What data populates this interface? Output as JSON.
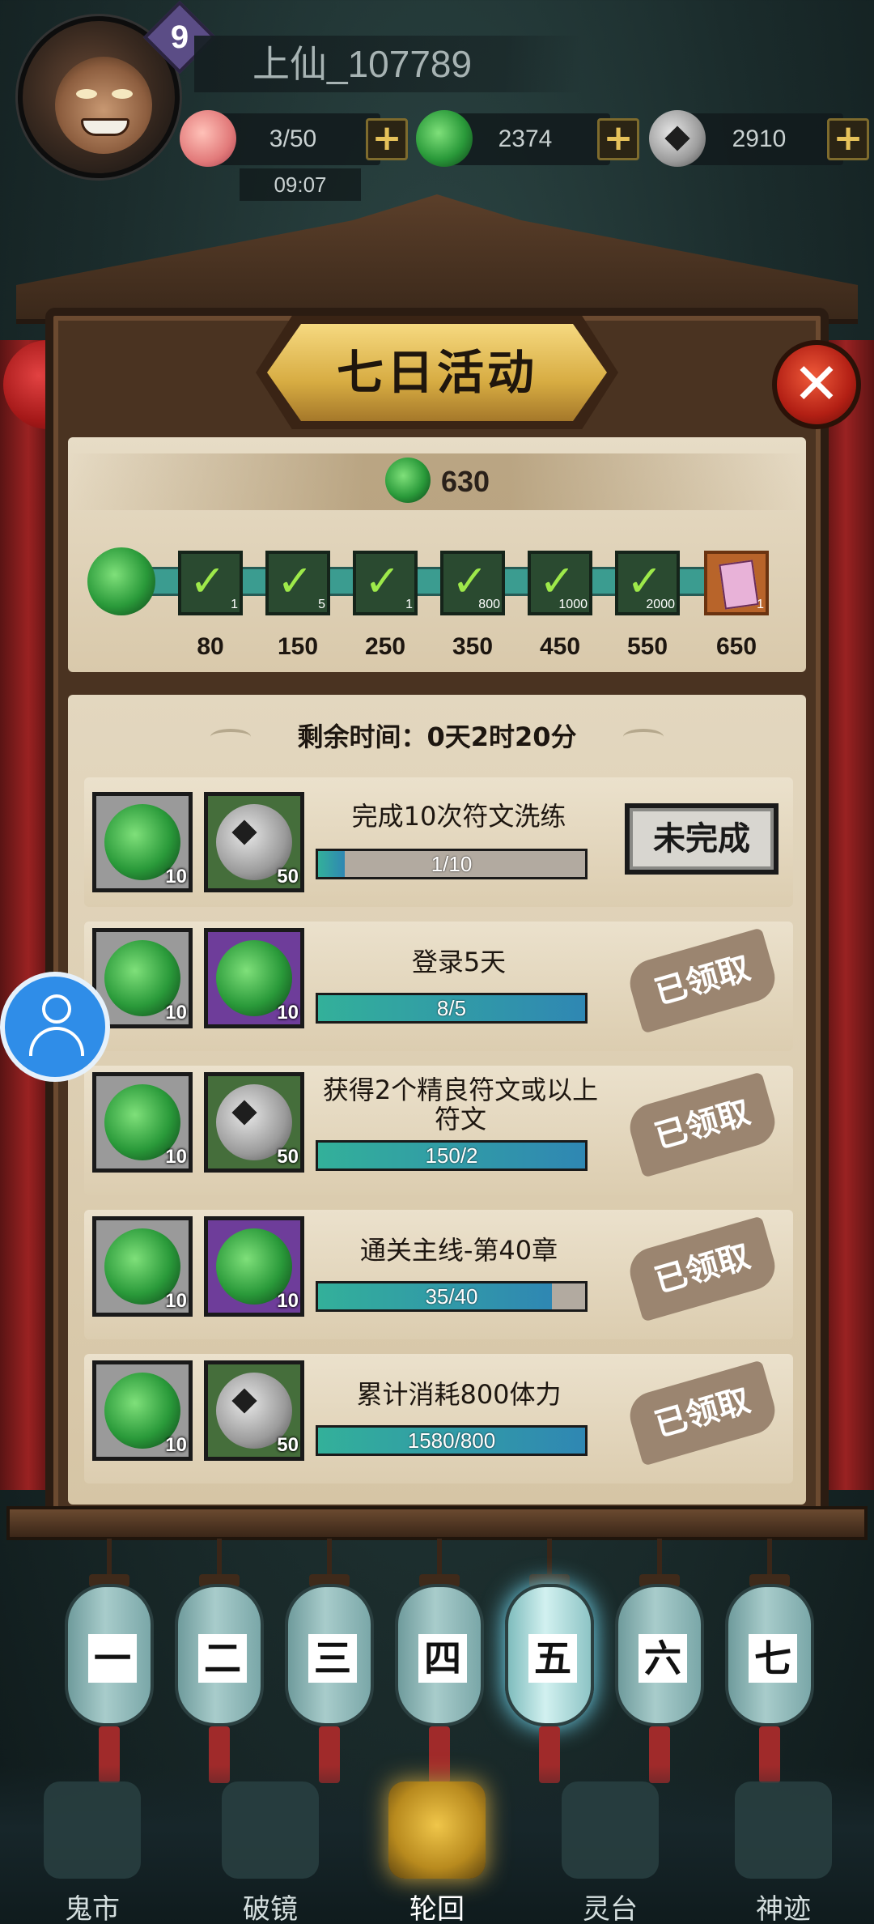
{
  "header": {
    "level": "9",
    "username": "上仙_107789",
    "stamina": "3/50",
    "jade": "2374",
    "coins": "2910",
    "timer": "09:07",
    "plus": "+"
  },
  "panel": {
    "title": "七日活动",
    "close": "✕",
    "points": "630",
    "milestones": [
      {
        "label": "80",
        "qty": "1"
      },
      {
        "label": "150",
        "qty": "5"
      },
      {
        "label": "250",
        "qty": "1"
      },
      {
        "label": "350",
        "qty": "800"
      },
      {
        "label": "450",
        "qty": "1000"
      },
      {
        "label": "550",
        "qty": "2000"
      },
      {
        "label": "650",
        "qty": "1"
      }
    ],
    "remaining": "剩余时间：0天2时20分"
  },
  "tasks": [
    {
      "name": "完成10次符文洗练",
      "r1": "10",
      "r2": "50",
      "progress": "1/10",
      "fill": 0.1,
      "status": "未完成"
    },
    {
      "name": "登录5天",
      "r1": "10",
      "r2": "10",
      "progress": "8/5",
      "fill": 1.0,
      "status": "已领取"
    },
    {
      "name": "获得2个精良符文或以上符文",
      "r1": "10",
      "r2": "50",
      "progress": "150/2",
      "fill": 1.0,
      "status": "已领取"
    },
    {
      "name": "通关主线-第40章",
      "r1": "10",
      "r2": "10",
      "progress": "35/40",
      "fill": 0.875,
      "status": "已领取"
    },
    {
      "name": "累计消耗800体力",
      "r1": "10",
      "r2": "50",
      "progress": "1580/800",
      "fill": 1.0,
      "status": "已领取"
    }
  ],
  "days": [
    "一",
    "二",
    "三",
    "四",
    "五",
    "六",
    "七"
  ],
  "active_day": "五",
  "nav": [
    "鬼市",
    "破镜",
    "轮回",
    "灵台",
    "神迹"
  ],
  "active_nav": "轮回",
  "colors": {
    "accent_gold": "#d7ac42",
    "progress": "#33b09a",
    "close_red": "#b21f14"
  }
}
